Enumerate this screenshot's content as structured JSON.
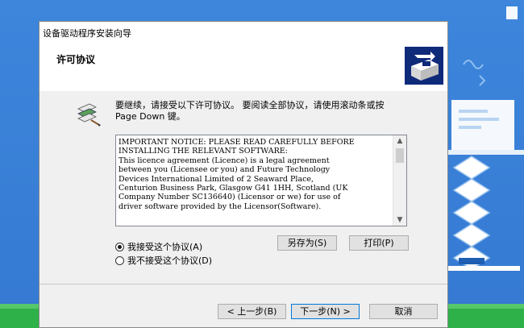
{
  "window": {
    "title": "设备驱动程序安装向导"
  },
  "header": {
    "title": "许可协议"
  },
  "intro": {
    "text": "要继续，请接受以下许可协议。 要阅读全部协议，请使用滚动条或按 Page Down 键。"
  },
  "license": {
    "text": "IMPORTANT NOTICE: PLEASE READ CAREFULLY BEFORE\nINSTALLING THE RELEVANT SOFTWARE:\nThis licence agreement (Licence) is a legal agreement\nbetween you (Licensee or you) and Future Technology\nDevices International Limited of 2 Seaward Place,\nCenturion Business Park, Glasgow G41 1HH, Scotland (UK\nCompany Number SC136640) (Licensor or we) for use of\ndriver software provided by the Licensor(Software)."
  },
  "options": {
    "accept": "我接受这个协议(A)",
    "decline": "我不接受这个协议(D)",
    "selected": "accept"
  },
  "buttons": {
    "save_as": "另存为(S)",
    "print": "打印(P)",
    "back": "< 上一步(B)",
    "next": "下一步(N) >",
    "cancel": "取消"
  },
  "background": {
    "side_text_1": "",
    "side_text_2": ""
  },
  "colors": {
    "desktop_blue": "#3a7fd6",
    "dialog_face": "#f0f0f0",
    "header_icon": "#102a7a",
    "focus_border": "#0078d7"
  }
}
